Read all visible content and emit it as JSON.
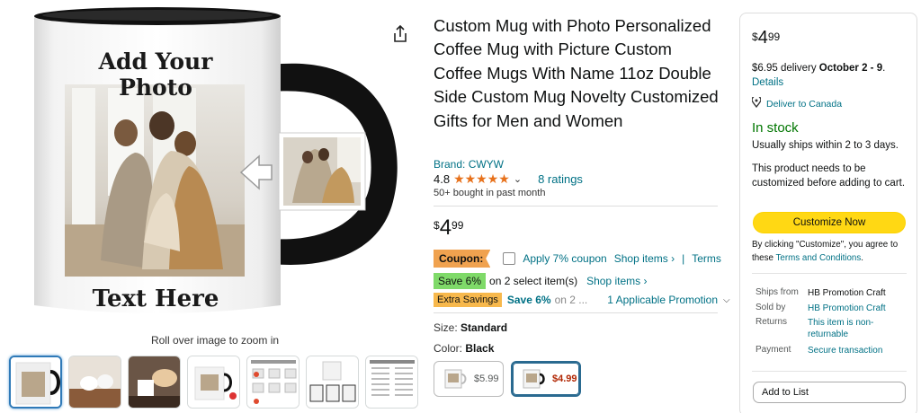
{
  "product": {
    "title": "Custom Mug with Photo Personalized Coffee Mug with Picture Custom Coffee Mugs With Name 11oz Double Side Custom Mug Novelty Customized Gifts for Men and Women",
    "brand": "Brand: CWYW",
    "rating": "4.8",
    "stars": "★★★★★",
    "rating_value": 4.8,
    "ratings_count": "8 ratings",
    "bought": "50+ bought in past month",
    "mug_top_text": "Add Your Photo",
    "mug_bottom_text": "Text Here",
    "zoom_hint": "Roll over image to zoom in"
  },
  "price": {
    "symbol": "$",
    "whole": "4",
    "fraction": "99"
  },
  "coupon": {
    "badge": "Coupon:",
    "apply_text": "Apply 7% coupon",
    "shop_items": "Shop items ›",
    "separator": "|",
    "terms": "Terms"
  },
  "save": {
    "badge": "Save 6%",
    "text": "on 2 select item(s)",
    "shop_items": "Shop items ›"
  },
  "extra": {
    "badge": "Extra Savings",
    "save": "Save 6%",
    "more": "on 2 ...",
    "promotion": "1 Applicable Promotion"
  },
  "variations": {
    "size_label": "Size:",
    "size_value": "Standard",
    "color_label": "Color:",
    "color_value": "Black",
    "options": [
      {
        "price": "$5.99"
      },
      {
        "price": "$4.99"
      }
    ]
  },
  "buybox": {
    "price": {
      "symbol": "$",
      "whole": "4",
      "fraction": "99"
    },
    "delivery_prefix": "$6.95 delivery",
    "delivery_dates": "October 2 - 9",
    "delivery_suffix": ".",
    "details": "Details",
    "deliver_to": "Deliver to Canada",
    "stock": "In stock",
    "ships": "Usually ships within 2 to 3 days.",
    "needs_custom": "This product needs to be customized before adding to cart.",
    "customize_button": "Customize Now",
    "agree_prefix": "By clicking \"Customize\", you agree to these",
    "agree_link": "Terms and Conditions",
    "agree_suffix": ".",
    "ships_from_label": "Ships from",
    "ships_from_value": "HB Promotion Craft",
    "sold_by_label": "Sold by",
    "sold_by_value": "HB Promotion Craft",
    "returns_label": "Returns",
    "returns_value": "This item is non-returnable",
    "payment_label": "Payment",
    "payment_value": "Secure transaction",
    "add_to_list": "Add to List"
  },
  "colors": {
    "link": "#007185",
    "star": "#e7711b",
    "in_stock": "#007600",
    "customize_button": "#ffd814",
    "coupon_badge": "#f0a24f",
    "save_badge": "#7fda69",
    "extra_badge": "#f7b84c",
    "sale_price": "#b12704"
  },
  "icons": [
    "share-icon",
    "chevron-down-icon",
    "location-pin-icon",
    "chevron-right-icon"
  ]
}
